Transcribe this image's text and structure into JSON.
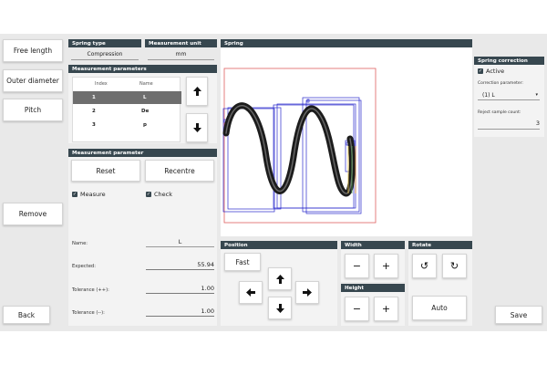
{
  "sidebar": {
    "free_length": "Free length",
    "outer_diameter": "Outer diameter",
    "pitch": "Pitch",
    "remove": "Remove",
    "back": "Back"
  },
  "spring_type": {
    "title": "Spring type",
    "value": "Compression"
  },
  "measurement_unit": {
    "title": "Measurement unit",
    "value": "mm"
  },
  "measurement_parameters": {
    "title": "Measurement parameters",
    "columns": [
      "Index",
      "Name"
    ],
    "rows": [
      {
        "index": "1",
        "name": "L",
        "selected": true
      },
      {
        "index": "2",
        "name": "De",
        "selected": false
      },
      {
        "index": "3",
        "name": "p",
        "selected": false
      }
    ],
    "selected_color": "#6e6e6e"
  },
  "measurement_parameter": {
    "title": "Measurement parameter",
    "reset": "Reset",
    "recentre": "Recentre",
    "measure_label": "Measure",
    "measure_checked": true,
    "check_label": "Check",
    "check_checked": true,
    "name_label": "Name:",
    "name_value": "L",
    "expected_label": "Expected:",
    "expected_value": "55.94",
    "tol_plus_label": "Tolerance (++):",
    "tol_plus_value": "1.00",
    "tol_minus_label": "Tolerance (--):",
    "tol_minus_value": "1.00"
  },
  "spring_view": {
    "title": "Spring",
    "roi_color": "#e06060",
    "box_color": "#2a2acc"
  },
  "position": {
    "title": "Position",
    "fast": "Fast"
  },
  "width": {
    "title": "Width"
  },
  "height": {
    "title": "Height"
  },
  "rotate": {
    "title": "Rotate",
    "auto": "Auto"
  },
  "spring_correction": {
    "title": "Spring correction",
    "active_label": "Active",
    "active_checked": true,
    "correction_param_label": "Correction parameter:",
    "correction_param_value": "(1) L",
    "reject_label": "Reject sample count:",
    "reject_value": "3"
  },
  "save": "Save",
  "theme": {
    "header_bg": "#37474f",
    "panel_bg": "#f3f3f3",
    "app_bg": "#e9e9e9"
  }
}
